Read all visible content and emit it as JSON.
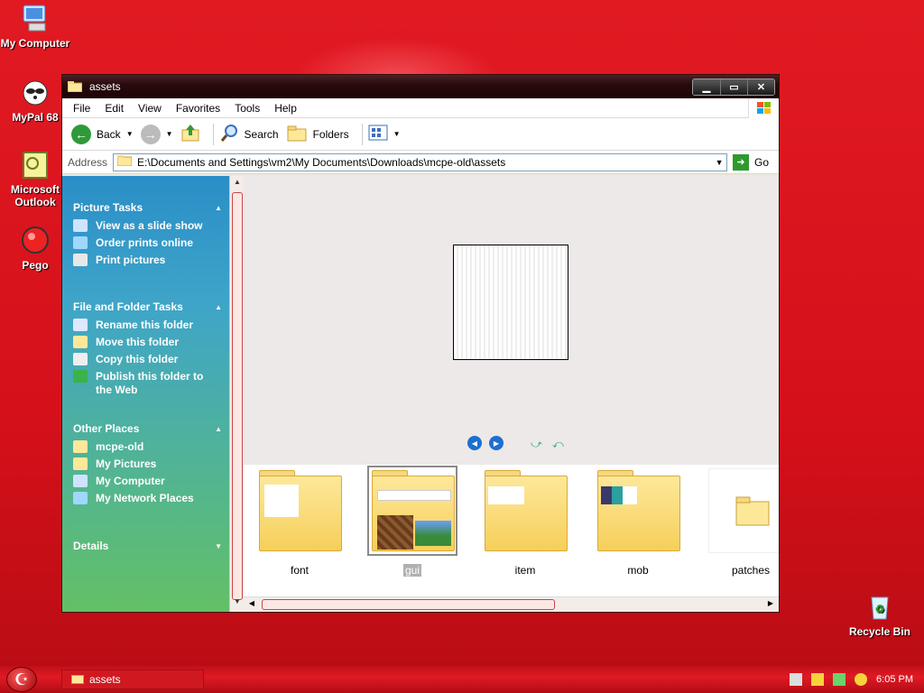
{
  "desktop": {
    "icons": [
      {
        "label": "My Computer"
      },
      {
        "label": "MyPal 68"
      },
      {
        "label": "Microsoft Outlook"
      },
      {
        "label": "Pego"
      },
      {
        "label": "Recycle Bin"
      }
    ]
  },
  "window": {
    "title": "assets",
    "menu": [
      "File",
      "Edit",
      "View",
      "Favorites",
      "Tools",
      "Help"
    ],
    "toolbar": {
      "back": "Back",
      "search": "Search",
      "folders": "Folders"
    },
    "address": {
      "label": "Address",
      "path": "E:\\Documents and Settings\\vm2\\My Documents\\Downloads\\mcpe-old\\assets",
      "go": "Go"
    },
    "taskpane": {
      "picture_tasks": {
        "title": "Picture Tasks",
        "items": [
          "View as a slide show",
          "Order prints online",
          "Print pictures"
        ]
      },
      "file_folder_tasks": {
        "title": "File and Folder Tasks",
        "items": [
          "Rename this folder",
          "Move this folder",
          "Copy this folder",
          "Publish this folder to the Web"
        ]
      },
      "other_places": {
        "title": "Other Places",
        "items": [
          "mcpe-old",
          "My Pictures",
          "My Computer",
          "My Network Places"
        ]
      },
      "details": {
        "title": "Details"
      }
    },
    "thumbnails": [
      {
        "name": "font"
      },
      {
        "name": "gui"
      },
      {
        "name": "item"
      },
      {
        "name": "mob"
      },
      {
        "name": "patches"
      }
    ]
  },
  "taskbar": {
    "task": "assets",
    "clock": "6:05 PM"
  }
}
